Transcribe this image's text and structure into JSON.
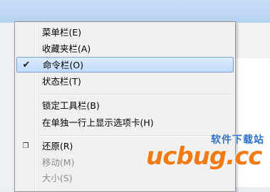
{
  "menu": {
    "items": [
      {
        "label": "菜单栏(E)",
        "checked": false,
        "disabled": false,
        "highlighted": false
      },
      {
        "label": "收藏夹栏(A)",
        "checked": false,
        "disabled": false,
        "highlighted": false
      },
      {
        "label": "命令栏(O)",
        "checked": true,
        "disabled": false,
        "highlighted": true
      },
      {
        "label": "状态栏(T)",
        "checked": false,
        "disabled": false,
        "highlighted": false
      },
      {
        "label": "锁定工具栏(B)",
        "checked": false,
        "disabled": false,
        "highlighted": false
      },
      {
        "label": "在单独一行上显示选项卡(H)",
        "checked": false,
        "disabled": false,
        "highlighted": false
      },
      {
        "label": "还原(R)",
        "icon": "restore-icon",
        "disabled": false,
        "highlighted": false
      },
      {
        "label": "移动(M)",
        "disabled": true,
        "highlighted": false
      },
      {
        "label": "大小(S)",
        "disabled": true,
        "highlighted": false
      }
    ],
    "check_glyph": "✔",
    "restore_glyph": "❐",
    "highlight_color": "#c1dbfc"
  },
  "watermark": {
    "top_text": "软件下载站",
    "main_text": "ucbug.cc",
    "main_color": "#f07b14",
    "top_color": "#2b6fcf"
  }
}
